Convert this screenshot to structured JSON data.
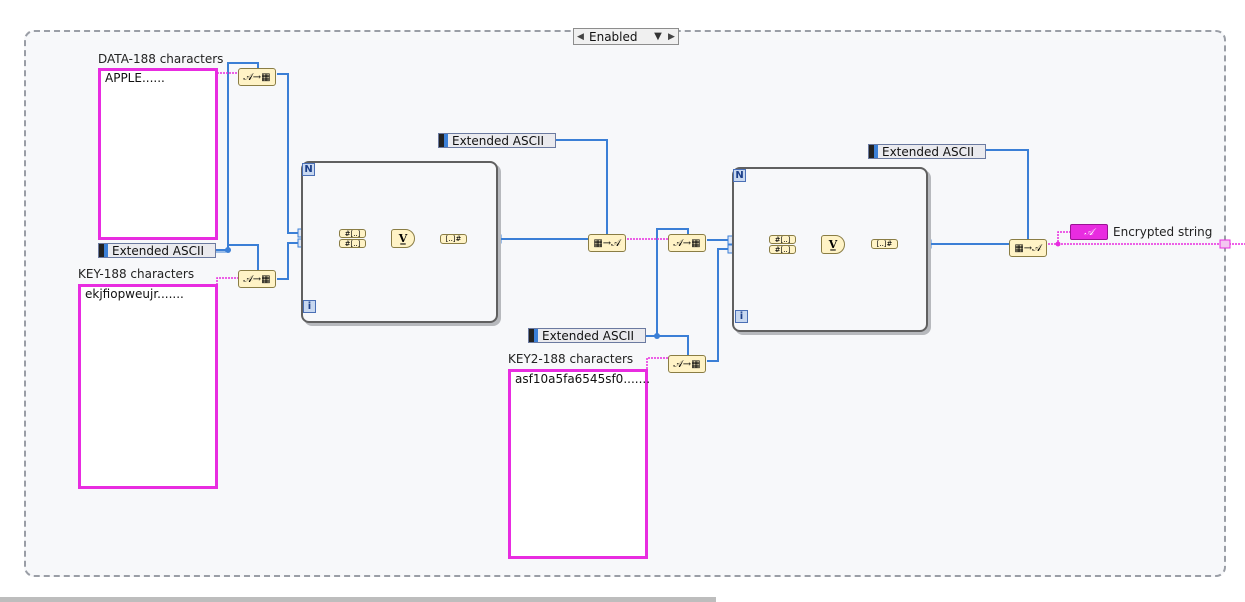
{
  "structure": {
    "selector_value": "Enabled"
  },
  "controls": {
    "data_label": "DATA-188 characters",
    "data_value": "APPLE......",
    "key_label": "KEY-188 characters",
    "key_value": "ekjfiopweujr.......",
    "key2_label": "KEY2-188 characters",
    "key2_value": "asf10a5fa6545sf0......."
  },
  "constants": {
    "ext_ascii_1": "Extended ASCII",
    "ext_ascii_2": "Extended ASCII",
    "ext_ascii_3": "Extended ASCII",
    "ext_ascii_4": "Extended ASCII"
  },
  "nodes": {
    "str_to_bytes": "𝒜→▦",
    "bytes_to_str": "▦→𝒜",
    "xor": "V̲",
    "index_array": "#[..]",
    "build_array": "[..]#"
  },
  "loops": {
    "count_terminal": "N",
    "iteration_terminal": "i"
  },
  "indicator": {
    "label": "Encrypted string",
    "icon": "𝒜"
  },
  "colors": {
    "string_wire": "#e82ce0",
    "numeric_wire": "#3b7fd6",
    "bool_wire": "#2f8f2f",
    "node_fill": "#fff3c6"
  }
}
